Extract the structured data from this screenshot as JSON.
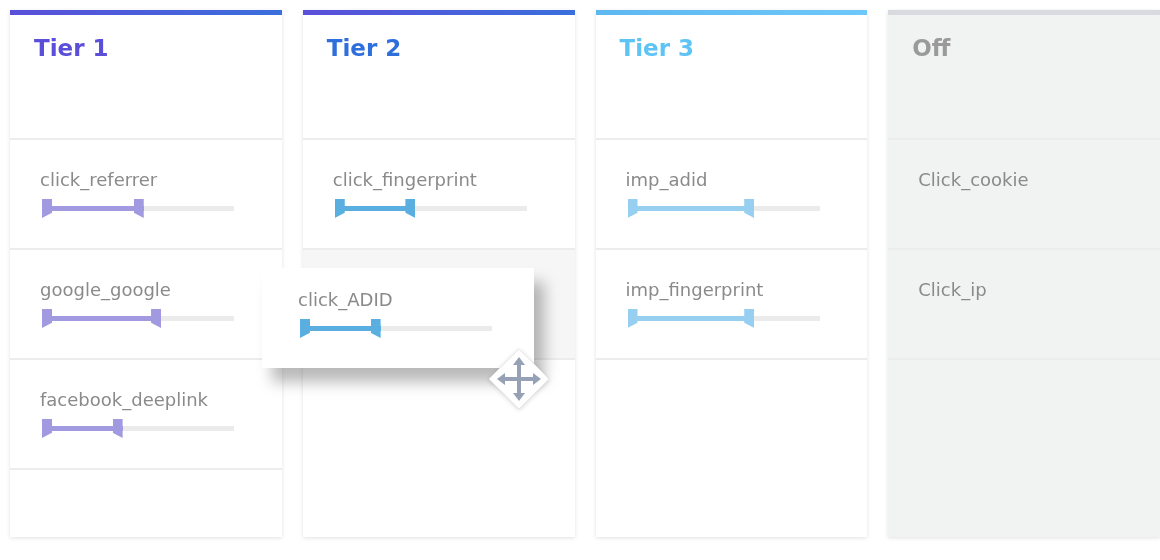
{
  "columns": [
    {
      "title": "Tier 1",
      "kind": "tier",
      "color": "#5b4fd9",
      "cards": [
        {
          "kind": "slider",
          "name": "click_referrer",
          "level": 0.53
        },
        {
          "kind": "slider",
          "name": "google_google",
          "level": 0.62
        },
        {
          "kind": "slider",
          "name": "facebook_deeplink",
          "level": 0.42
        }
      ]
    },
    {
      "title": "Tier 2",
      "kind": "tier",
      "color": "#2f6fdc",
      "cards": [
        {
          "kind": "slider",
          "name": "click_fingerprint",
          "level": 0.42
        },
        {
          "kind": "placeholder"
        }
      ]
    },
    {
      "title": "Tier 3",
      "kind": "tier",
      "color": "#5ec4f5",
      "cards": [
        {
          "kind": "slider",
          "name": "imp_adid",
          "level": 0.66
        },
        {
          "kind": "slider",
          "name": "imp_fingerprint",
          "level": 0.66
        }
      ]
    },
    {
      "title": "Off",
      "kind": "off",
      "color": "#9a9a9a",
      "cards": [
        {
          "kind": "plain",
          "name": "Click_cookie"
        },
        {
          "kind": "plain",
          "name": "Click_ip"
        }
      ]
    }
  ],
  "dragging": {
    "name": "click_ADID",
    "level": 0.42
  }
}
